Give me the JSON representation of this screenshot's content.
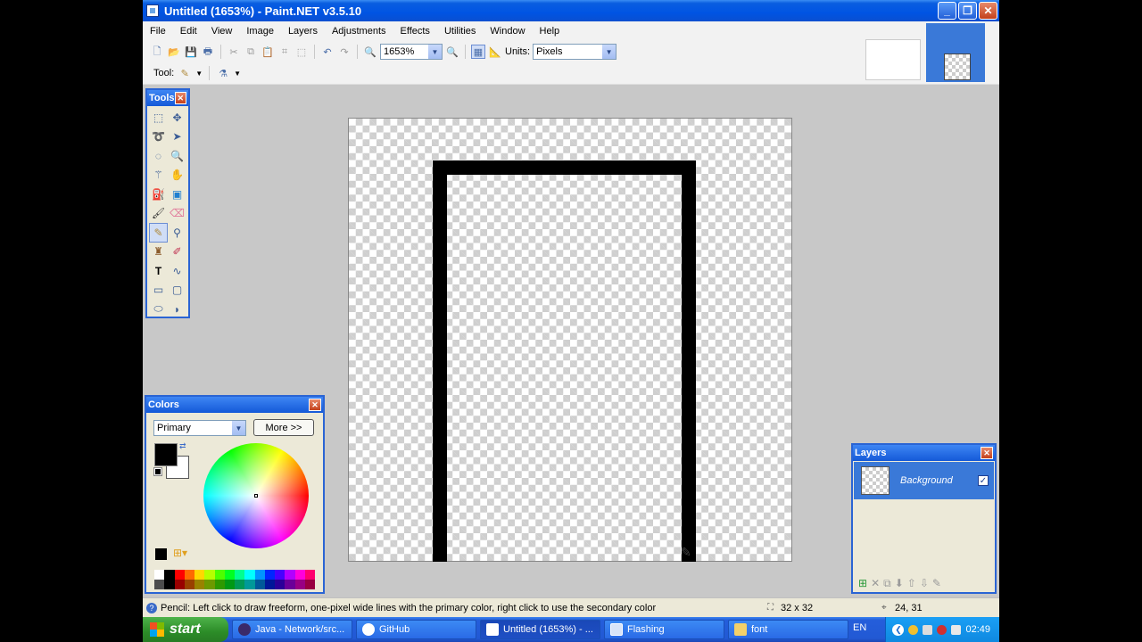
{
  "window": {
    "title": "Untitled (1653%) - Paint.NET v3.5.10"
  },
  "menu": [
    "File",
    "Edit",
    "View",
    "Image",
    "Layers",
    "Adjustments",
    "Effects",
    "Utilities",
    "Window",
    "Help"
  ],
  "toolbar": {
    "zoom_value": "1653%",
    "units_label": "Units:",
    "units_value": "Pixels",
    "tool_label": "Tool:"
  },
  "tools_panel": {
    "title": "Tools",
    "active_tool": "pencil"
  },
  "colors_panel": {
    "title": "Colors",
    "mode": "Primary",
    "more_label": "More >>",
    "primary": "#000000",
    "secondary": "#ffffff"
  },
  "palette": [
    "#ffffff",
    "#000000",
    "#ff0000",
    "#ff6a00",
    "#ffd800",
    "#b6ff00",
    "#4cff00",
    "#00ff21",
    "#00ff90",
    "#00ffff",
    "#0094ff",
    "#0026ff",
    "#4800ff",
    "#b200ff",
    "#ff00dc",
    "#ff006e"
  ],
  "layers_panel": {
    "title": "Layers",
    "layers": [
      {
        "name": "Background",
        "visible": true
      }
    ]
  },
  "status": {
    "hint": "Pencil: Left click to draw freeform, one-pixel wide lines with the primary color, right click to use the secondary color",
    "image_size": "32 x 32",
    "cursor_pos": "24, 31"
  },
  "taskbar": {
    "start_label": "start",
    "tasks": [
      {
        "label": "Java - Network/src...",
        "icon": "eclipse-icon",
        "active": false
      },
      {
        "label": "GitHub",
        "icon": "github-icon",
        "active": false
      },
      {
        "label": "Untitled (1653%) - ...",
        "icon": "paintnet-icon",
        "active": true
      },
      {
        "label": "Flashing",
        "icon": "window-icon",
        "active": false
      },
      {
        "label": "font",
        "icon": "folder-icon",
        "active": false
      }
    ],
    "language": "EN",
    "clock": "02:49"
  }
}
